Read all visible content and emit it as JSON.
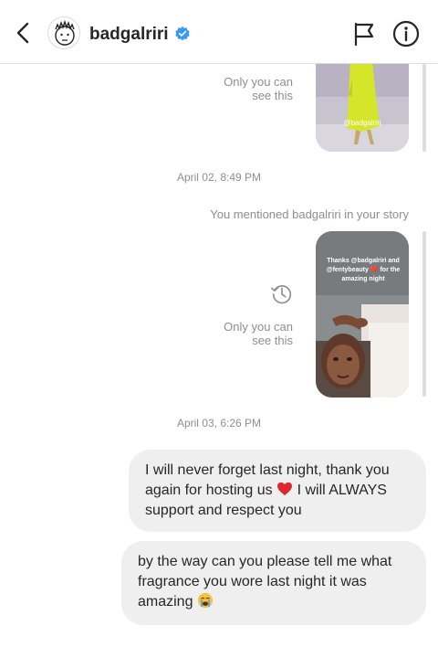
{
  "header": {
    "username": "badgalriri",
    "back_icon": "chevron-left-icon",
    "verified_icon": "verified-badge-icon",
    "flag_icon": "flag-icon",
    "info_icon": "info-icon"
  },
  "thread": {
    "story1": {
      "caption_line1": "Only you can",
      "caption_line2": "see this",
      "watermark": "@badgalriri"
    },
    "timestamp1": "April 02, 8:49 PM",
    "mention_text": "You mentioned badgalriri in your story",
    "story2": {
      "overlay_text": "Thanks @badgalriri and @fentybeauty ❤️ for the amazing night",
      "caption_line1": "Only you can",
      "caption_line2": "see this",
      "replay_icon": "replay-history-icon"
    },
    "timestamp2": "April 03, 6:26 PM",
    "messages": [
      {
        "part1": "I will never forget last night, thank you again for hosting us",
        "emoji": "red-heart",
        "part2": "I will ALWAYS support and respect you"
      },
      {
        "part1": "by the way can you please tell me what fragrance you wore last night it was amazing",
        "emoji": "loudly-crying-face"
      }
    ]
  },
  "colors": {
    "bubble_bg": "#efefef",
    "text": "#262626",
    "meta_text": "#8e8e8e",
    "verified_blue": "#3897f0"
  }
}
